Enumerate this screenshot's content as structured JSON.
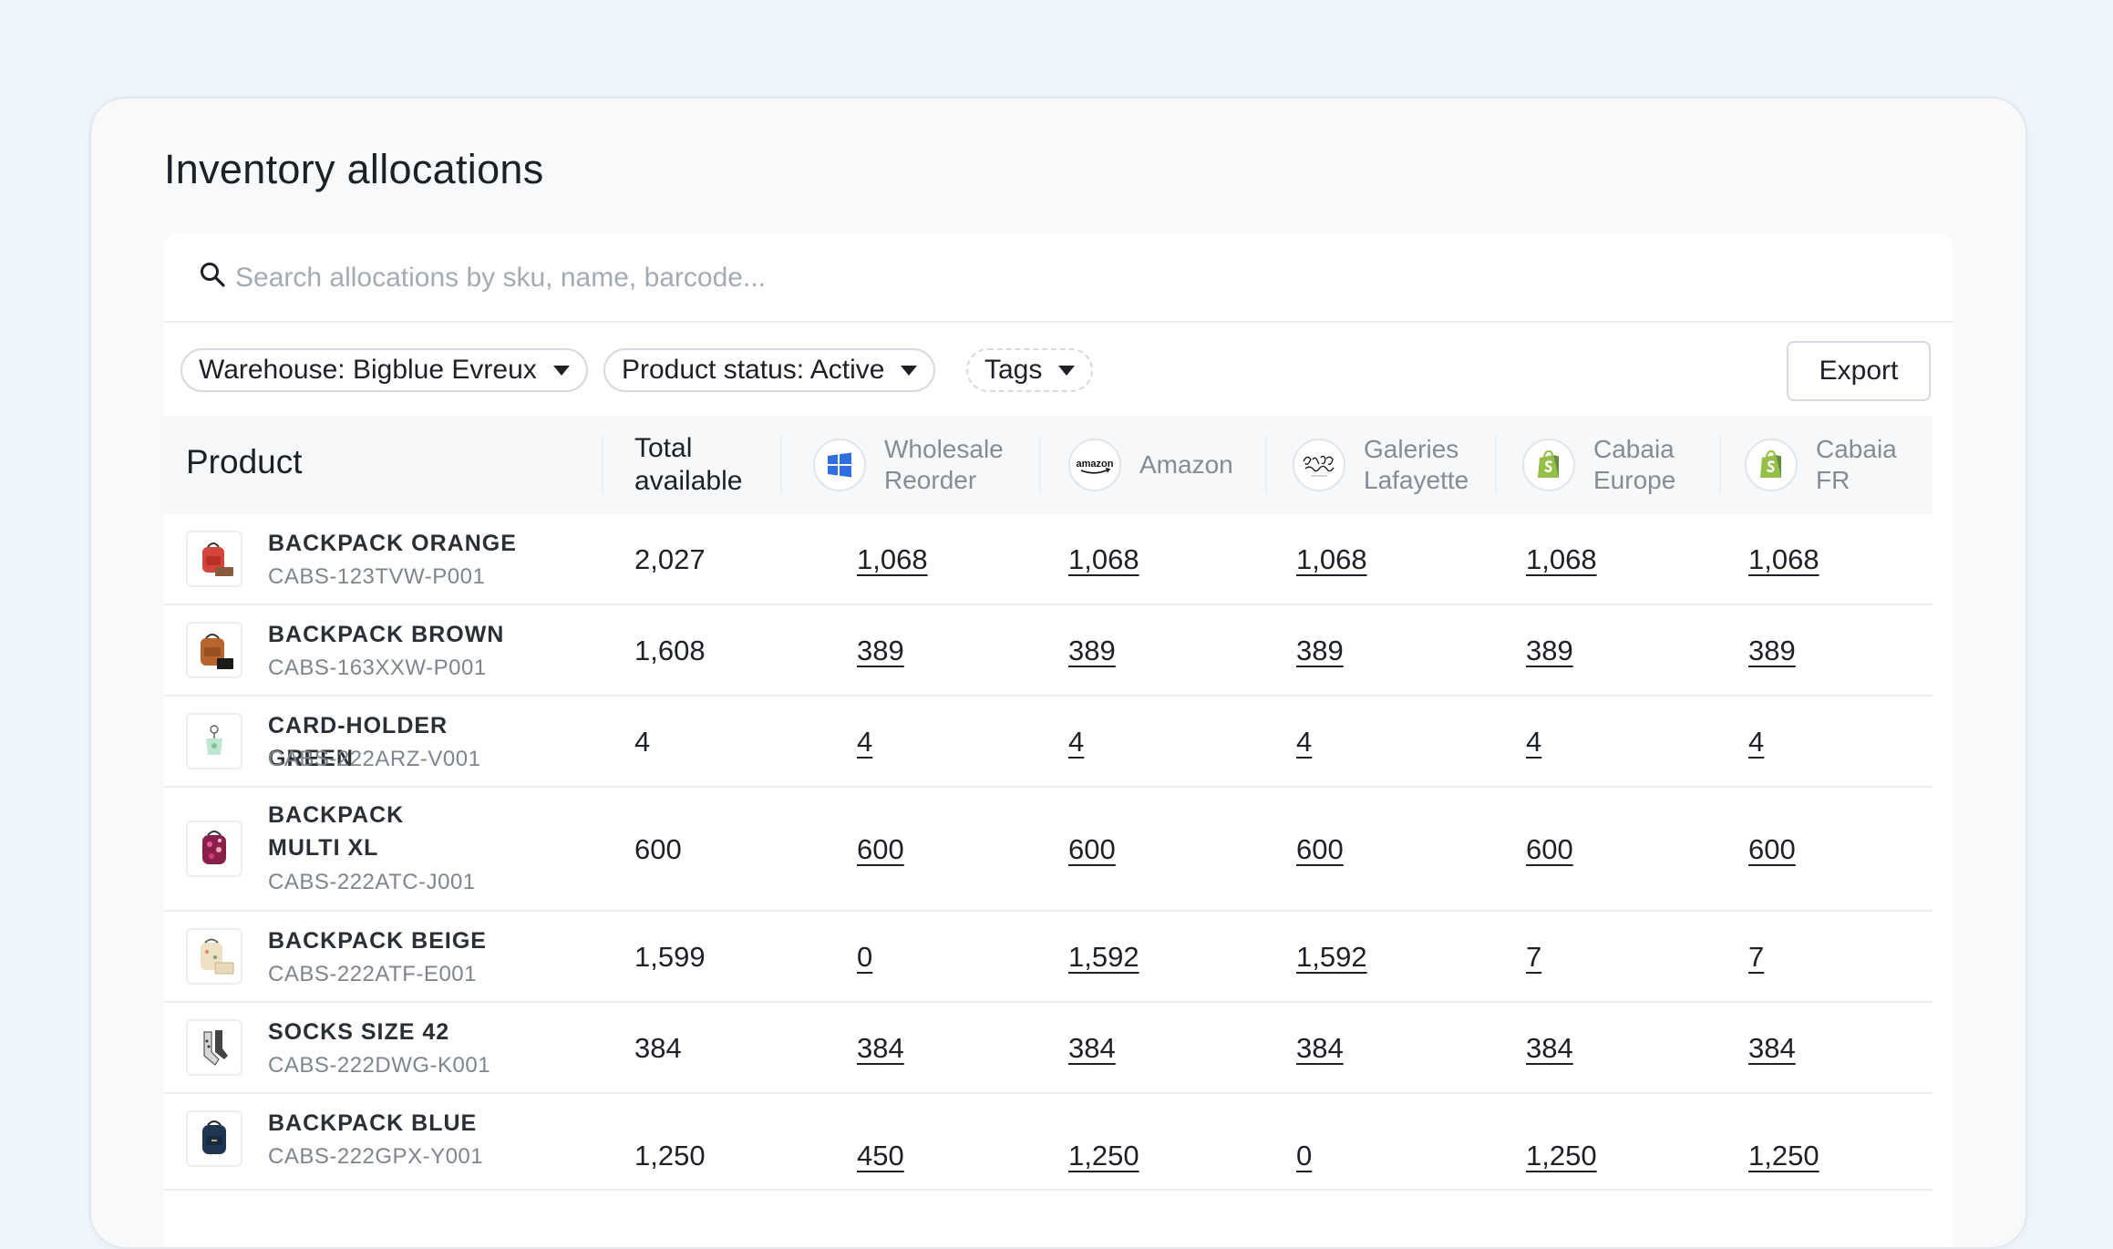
{
  "page": {
    "title": "Inventory allocations"
  },
  "search": {
    "placeholder": "Search allocations by sku, name, barcode..."
  },
  "filters": [
    {
      "label": "Warehouse: Bigblue Evreux"
    },
    {
      "label": "Product status: Active"
    },
    {
      "label": "Tags"
    }
  ],
  "export_label": "Export",
  "table": {
    "product_header": "Product",
    "total_header_line1": "Total",
    "total_header_line2": "available",
    "channels": [
      {
        "line1": "Wholesale",
        "line2": "Reorder",
        "icon": "windows-icon"
      },
      {
        "line1": "Amazon",
        "line2": "",
        "icon": "amazon-logo-icon"
      },
      {
        "line1": "Galeries",
        "line2": "Lafayette",
        "icon": "galeries-lafayette-logo-icon"
      },
      {
        "line1": "Cabaia",
        "line2": "Europe",
        "icon": "shopify-icon"
      },
      {
        "line1": "Cabaia",
        "line2": "FR",
        "icon": "shopify-icon"
      }
    ],
    "rows": [
      {
        "name": "BACKPACK ORANGE",
        "sku": "CABS-123TVW-P001",
        "total": "2,027",
        "alloc": [
          "1,068",
          "1,068",
          "1,068",
          "1,068",
          "1,068"
        ]
      },
      {
        "name": "BACKPACK BROWN",
        "sku": "CABS-163XXW-P001",
        "total": "1,608",
        "alloc": [
          "389",
          "389",
          "389",
          "389",
          "389"
        ]
      },
      {
        "name": "CARD-HOLDER GREEN",
        "sku": "CABS-222ARZ-V001",
        "total": "4",
        "alloc": [
          "4",
          "4",
          "4",
          "4",
          "4"
        ]
      },
      {
        "name": "BACKPACK MULTI XL",
        "sku": "CABS-222ATC-J001",
        "total": "600",
        "alloc": [
          "600",
          "600",
          "600",
          "600",
          "600"
        ]
      },
      {
        "name": "BACKPACK BEIGE",
        "sku": "CABS-222ATF-E001",
        "total": "1,599",
        "alloc": [
          "0",
          "1,592",
          "1,592",
          "7",
          "7"
        ]
      },
      {
        "name": "SOCKS SIZE 42",
        "sku": "CABS-222DWG-K001",
        "total": "384",
        "alloc": [
          "384",
          "384",
          "384",
          "384",
          "384"
        ]
      },
      {
        "name": "BACKPACK BLUE",
        "sku": "CABS-222GPX-Y001",
        "total": "1,250",
        "alloc": [
          "450",
          "1,250",
          "0",
          "1,250",
          "1,250"
        ]
      }
    ]
  },
  "colors": {
    "background": "#eef5fc",
    "card": "#f8f9fa",
    "text": "#1d2127",
    "muted": "#858c96",
    "windows_blue": "#2f6fe0",
    "shopify_green": "#95bf47"
  }
}
